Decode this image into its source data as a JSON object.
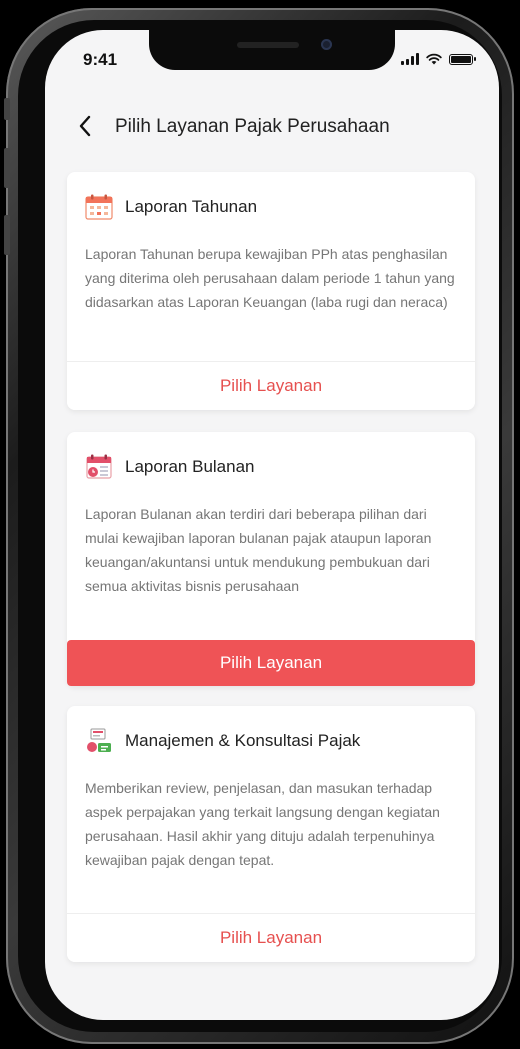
{
  "status_bar": {
    "time": "9:41"
  },
  "header": {
    "back_icon": "chevron-left-icon",
    "title": "Pilih Layanan Pajak Perusahaan"
  },
  "services": [
    {
      "icon": "calendar-icon",
      "title": "Laporan Tahunan",
      "description": "Laporan Tahunan berupa kewajiban PPh atas penghasilan yang diterima oleh perusahaan dalam periode 1 tahun yang didasarkan atas Laporan Keuangan (laba rugi dan neraca)",
      "button_label": "Pilih Layanan",
      "selected": false
    },
    {
      "icon": "calendar-clock-icon",
      "title": "Laporan Bulanan",
      "description": "Laporan Bulanan akan terdiri dari beberapa pilihan dari mulai kewajiban laporan bulanan pajak ataupun laporan keuangan/akuntansi untuk mendukung pembukuan dari semua aktivitas bisnis perusahaan",
      "button_label": "Pilih Layanan",
      "selected": true
    },
    {
      "icon": "tax-consult-icon",
      "title": "Manajemen & Konsultasi Pajak",
      "description": "Memberikan review, penjelasan, dan masukan terhadap aspek perpajakan yang terkait langsung dengan kegiatan perusahaan. Hasil akhir yang dituju adalah terpenuhinya kewajiban pajak dengan tepat.",
      "button_label": "Pilih Layanan",
      "selected": false
    }
  ],
  "colors": {
    "accent": "#ef5356",
    "accent_text": "#e6504f",
    "background": "#f5f5f6"
  }
}
